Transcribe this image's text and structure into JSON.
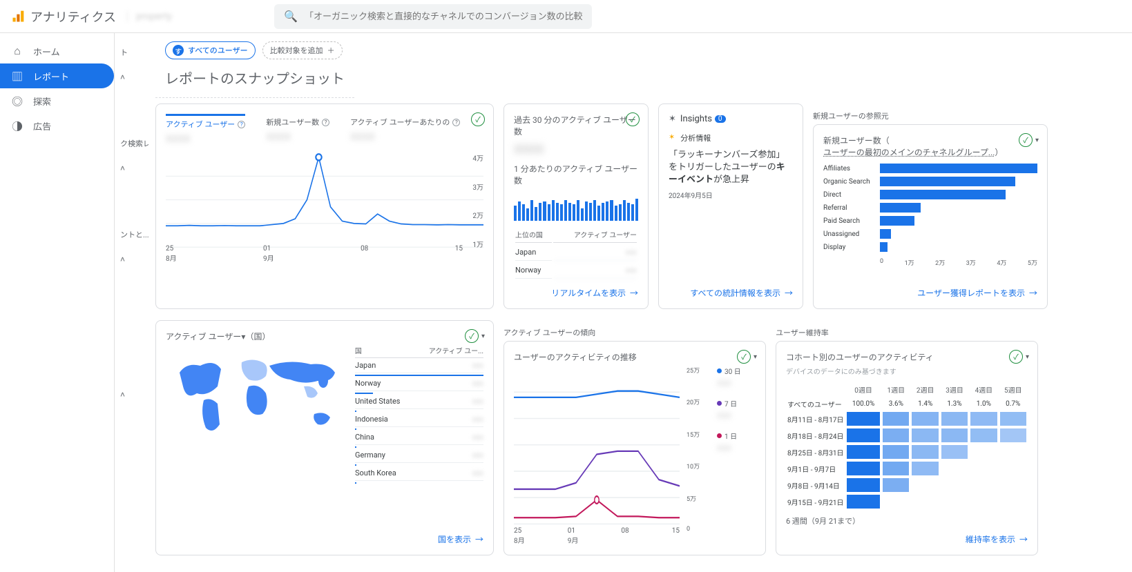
{
  "header": {
    "app_name": "アナリティクス",
    "property": "property",
    "search_placeholder": "「オーガニック検索と直接的なチャネルでのコンバージョン数の比較」と検..."
  },
  "sidebar": {
    "items": [
      {
        "label": "ホーム",
        "icon": "⌂"
      },
      {
        "label": "レポート",
        "icon": "▥"
      },
      {
        "label": "探索",
        "icon": "◎"
      },
      {
        "label": "広告",
        "icon": "◑"
      }
    ]
  },
  "secondary": [
    "ト",
    "ク検索レ...",
    "ントと..."
  ],
  "pills": {
    "all_users": "すべてのユーザー",
    "add_compare": "比較対象を追加"
  },
  "page_title": "レポートのスナップショット",
  "section_labels": {
    "new_user_source": "新規ユーザーの参照元",
    "active_user_trend": "アクティブ ユーザーの傾向",
    "retention": "ユーザー維持率"
  },
  "overview_card": {
    "metrics": [
      {
        "label": "アクティブ ユーザー",
        "value": "xxxx"
      },
      {
        "label": "新規ユーザー数",
        "value": "xxxx"
      },
      {
        "label": "アクティブ ユーザーあたりの",
        "value": "xxxx"
      }
    ],
    "y_ticks": [
      "4万",
      "3万",
      "2万",
      "1万"
    ],
    "x_ticks": [
      "25\n8月",
      "01\n9月",
      "08",
      "15"
    ],
    "chart_data": {
      "type": "line",
      "x": [
        25,
        26,
        27,
        28,
        29,
        30,
        31,
        1,
        2,
        3,
        4,
        5,
        6,
        7,
        8,
        9,
        10,
        11,
        12,
        13,
        14,
        15,
        16,
        17,
        18,
        19,
        20,
        21
      ],
      "values": [
        9000,
        9000,
        9200,
        9000,
        9000,
        9100,
        9000,
        9000,
        9000,
        9500,
        10000,
        12000,
        20000,
        38000,
        17000,
        11000,
        10000,
        9800,
        14000,
        11000,
        9800,
        9500,
        9500,
        9400,
        9500,
        9400,
        9400,
        9400
      ],
      "ylim": [
        0,
        40000
      ]
    }
  },
  "realtime_card": {
    "title": "過去 30 分のアクティブ ユーザー数",
    "big_value": "xxxx",
    "sub": "1 分あたりのアクティブ ユーザー数",
    "bar_values": [
      22,
      28,
      24,
      18,
      30,
      20,
      26,
      28,
      24,
      30,
      26,
      24,
      30,
      26,
      24,
      30,
      18,
      28,
      26,
      30,
      22,
      26,
      28,
      30,
      22,
      24,
      30,
      26,
      24,
      32
    ],
    "table_head": [
      "上位の国",
      "アクティブ ユーザー"
    ],
    "rows": [
      {
        "country": "Japan",
        "value": "xxx"
      },
      {
        "country": "Norway",
        "value": "xxx"
      }
    ],
    "link": "リアルタイムを表示"
  },
  "insights_card": {
    "title": "Insights",
    "badge": "0",
    "detail_label": "分析情報",
    "text_pre": "「ラッキーナンバーズ参加」をトリガーしたユーザーの",
    "text_bold": "キーイベント",
    "text_post": "が急上昇",
    "date": "2024年9月5日",
    "link": "すべての統計情報を表示"
  },
  "acquisition_card": {
    "title_a": "新規ユーザー数（",
    "title_b": "ユーザーの最初のメインのチャネルグループ...",
    "title_c": "）",
    "chart_data": {
      "type": "bar",
      "categories": [
        "Affiliates",
        "Organic Search",
        "Direct",
        "Referral",
        "Paid Search",
        "Unassigned",
        "Display"
      ],
      "values": [
        50000,
        43000,
        40000,
        13000,
        11000,
        3500,
        2500
      ],
      "xlim": [
        0,
        50000
      ],
      "x_ticks": [
        "0",
        "1万",
        "2万",
        "3万",
        "4万",
        "5万"
      ]
    },
    "link": "ユーザー獲得レポートを表示"
  },
  "country_card": {
    "title": "アクティブ ユーザー▾（国）",
    "table_head": [
      "国",
      "アクティブ ユー..."
    ],
    "rows": [
      {
        "name": "Japan",
        "bar": 100,
        "value": "xxx"
      },
      {
        "name": "Norway",
        "bar": 14,
        "value": "xxx"
      },
      {
        "name": "United States",
        "bar": 1,
        "value": "xxx"
      },
      {
        "name": "Indonesia",
        "bar": 1,
        "value": "xxx"
      },
      {
        "name": "China",
        "bar": 1,
        "value": "xxx"
      },
      {
        "name": "Germany",
        "bar": 1,
        "value": "xxx"
      },
      {
        "name": "South Korea",
        "bar": 1,
        "value": "xxx"
      }
    ],
    "link": "国を表示"
  },
  "activity_card": {
    "title": "ユーザーのアクティビティの推移",
    "legends": [
      {
        "label": "30 日",
        "color": "#1a73e8",
        "value": "xxx"
      },
      {
        "label": "7 日",
        "color": "#673ab7",
        "value": "xxx"
      },
      {
        "label": "1 日",
        "color": "#c2185b",
        "value": "xxx"
      }
    ],
    "y_ticks": [
      "25万",
      "20万",
      "15万",
      "10万",
      "5万",
      "0"
    ],
    "x_ticks": [
      "25\n8月",
      "01\n9月",
      "08",
      "15"
    ],
    "chart_data": {
      "type": "line",
      "x": [
        25,
        28,
        1,
        4,
        8,
        11,
        15,
        18,
        21
      ],
      "series": [
        {
          "name": "30日",
          "values": [
            200000,
            200000,
            200000,
            200000,
            205000,
            210000,
            210000,
            205000,
            200000
          ]
        },
        {
          "name": "7日",
          "values": [
            55000,
            55000,
            55000,
            65000,
            110000,
            115000,
            115000,
            70000,
            60000
          ]
        },
        {
          "name": "1日",
          "values": [
            10000,
            10000,
            10000,
            12000,
            38000,
            12000,
            12000,
            10000,
            10000
          ]
        }
      ],
      "ylim": [
        0,
        250000
      ]
    }
  },
  "cohort_card": {
    "title": "コホート別のユーザーのアクティビティ",
    "sub": "デバイスのデータにのみ基づきます",
    "cols": [
      "",
      "0週目",
      "1週目",
      "2週目",
      "3週目",
      "4週目",
      "5週目"
    ],
    "row_all": {
      "label": "すべてのユーザー",
      "vals": [
        "100.0%",
        "3.6%",
        "1.4%",
        "1.3%",
        "1.0%",
        "0.7%"
      ]
    },
    "rows": [
      {
        "label": "8月11日 - 8月17日",
        "shades": [
          100,
          55,
          45,
          42,
          40,
          38
        ]
      },
      {
        "label": "8月18日 - 8月24日",
        "shades": [
          100,
          50,
          42,
          42,
          38,
          30
        ]
      },
      {
        "label": "8月25日 - 8月31日",
        "shades": [
          100,
          55,
          42,
          35,
          0,
          0
        ]
      },
      {
        "label": "9月1日 - 9月7日",
        "shades": [
          100,
          55,
          40,
          0,
          0,
          0
        ]
      },
      {
        "label": "9月8日 - 9月14日",
        "shades": [
          100,
          50,
          0,
          0,
          0,
          0
        ]
      },
      {
        "label": "9月15日 - 9月21日",
        "shades": [
          100,
          0,
          0,
          0,
          0,
          0
        ]
      }
    ],
    "note": "6 週間（9月 21まで）",
    "link": "維持率を表示"
  }
}
